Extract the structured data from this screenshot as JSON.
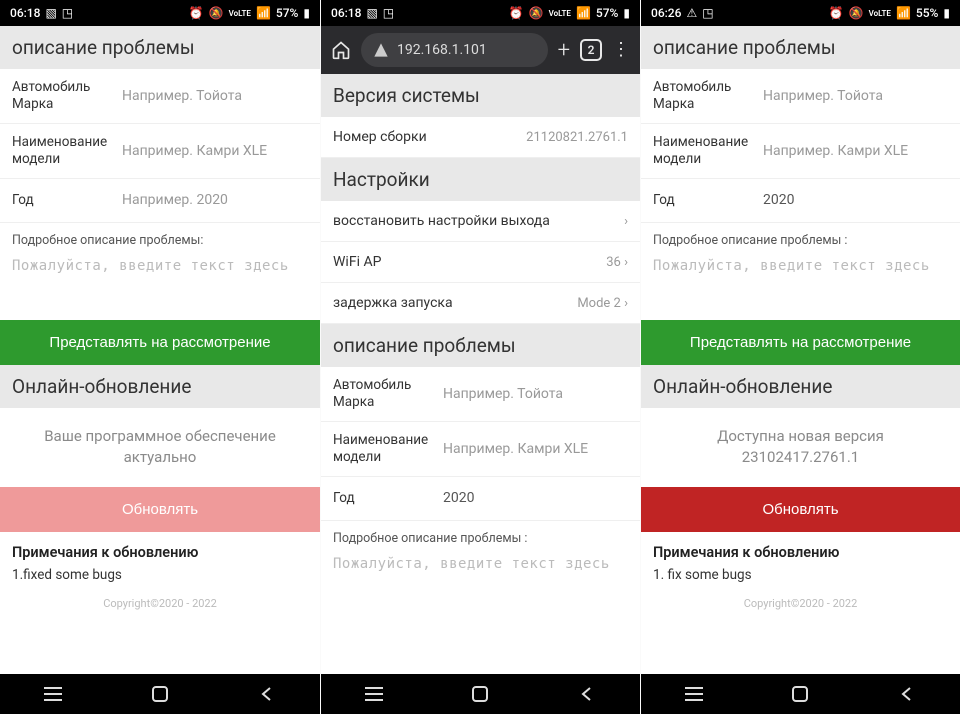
{
  "phones": [
    {
      "status": {
        "time": "06:18",
        "battery": "57%"
      },
      "problem_header": "описание проблемы",
      "fields": {
        "make_label": "Автомобиль Марка",
        "make_ph": "Например. Тойота",
        "model_label": "Наименование модели",
        "model_ph": "Например. Камри XLE",
        "year_label": "Год",
        "year_ph": "Например. 2020"
      },
      "desc_label": "Подробное описание проблемы:",
      "desc_ph": "Пожалуйста, введите текст здесь",
      "submit": "Представлять на рассмотрение",
      "update_header": "Онлайн-обновление",
      "update_msg": "Ваше программное обеспечение актуально",
      "update_btn": "Обновлять",
      "notes_title": "Примечания к обновлению",
      "notes_body": "1.fixed some bugs",
      "copyright": "Copyright©2020 - 2022"
    },
    {
      "status": {
        "time": "06:18",
        "battery": "57%"
      },
      "browser": {
        "url": "192.168.1.101",
        "tabs": "2"
      },
      "sysver_header": "Версия системы",
      "build_label": "Номер сборки",
      "build_value": "21120821.2761.1",
      "settings_header": "Настройки",
      "settings": [
        {
          "label": "восстановить настройки выхода",
          "value": ""
        },
        {
          "label": "WiFi AP",
          "value": "36"
        },
        {
          "label": "задержка запуска",
          "value": "Mode 2"
        }
      ],
      "problem_header": "описание проблемы",
      "fields": {
        "make_label": "Автомобиль Марка",
        "make_ph": "Например. Тойота",
        "model_label": "Наименование модели",
        "model_ph": "Например. Камри XLE",
        "year_label": "Год",
        "year_val": "2020"
      },
      "desc_label": "Подробное описание проблемы :",
      "desc_ph": "Пожалуйста, введите текст здесь"
    },
    {
      "status": {
        "time": "06:26",
        "battery": "55%"
      },
      "problem_header": "описание проблемы",
      "fields": {
        "make_label": "Автомобиль Марка",
        "make_ph": "Например. Тойота",
        "model_label": "Наименование модели",
        "model_ph": "Например. Камри XLE",
        "year_label": "Год",
        "year_val": "2020"
      },
      "desc_label": "Подробное описание проблемы :",
      "desc_ph": "Пожалуйста, введите текст здесь",
      "submit": "Представлять на рассмотрение",
      "update_header": "Онлайн-обновление",
      "update_msg": "Доступна новая версия 23102417.2761.1",
      "update_btn": "Обновлять",
      "notes_title": "Примечания к обновлению",
      "notes_body": "1. fix some bugs",
      "copyright": "Copyright©2020 - 2022"
    }
  ]
}
